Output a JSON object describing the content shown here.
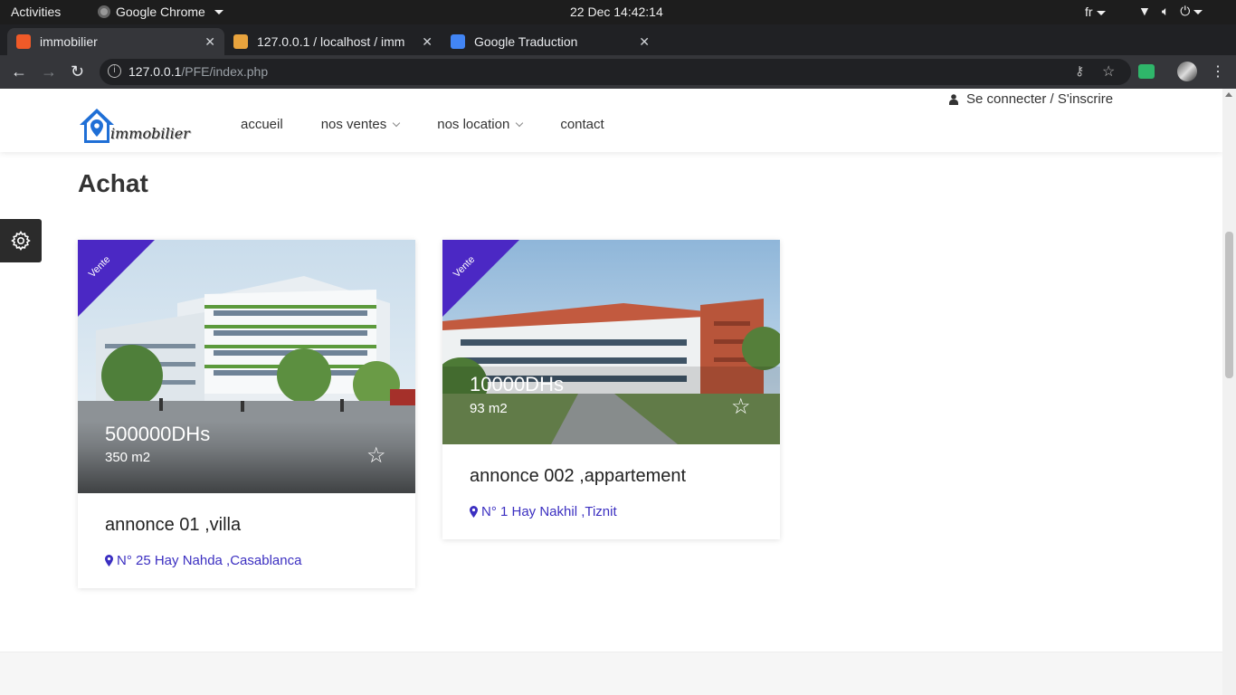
{
  "os": {
    "activities": "Activities",
    "app_name": "Google Chrome",
    "clock": "22 Dec  14:42:14",
    "lang": "fr"
  },
  "tabs": [
    {
      "title": "immobilier",
      "favicon_color": "#f05a28"
    },
    {
      "title": "127.0.0.1 / localhost / imm",
      "favicon_color": "#e8a33d"
    },
    {
      "title": "Google Traduction",
      "favicon_color": "#4285f4"
    }
  ],
  "address_bar": {
    "host": "127.0.0.1",
    "path": "/PFE/index.php"
  },
  "site": {
    "logo_text": "immobilier",
    "nav": [
      "accueil",
      "nos ventes",
      "nos location",
      "contact"
    ],
    "login": "Se connecter / S'inscrire",
    "accent_color": "#4b28c4",
    "link_color": "#3b2fc1"
  },
  "section": {
    "title": "Achat"
  },
  "listings": [
    {
      "badge": "Vente",
      "price": "500000DHs",
      "area": "350 m2",
      "title": "annonce 01 ,villa",
      "address": "N° 25 Hay Nahda ,Casablanca"
    },
    {
      "badge": "Vente",
      "price": "10000DHs",
      "area": "93 m2",
      "title": "annonce 002 ,appartement",
      "address": "N° 1 Hay Nakhil ,Tiznit"
    }
  ]
}
